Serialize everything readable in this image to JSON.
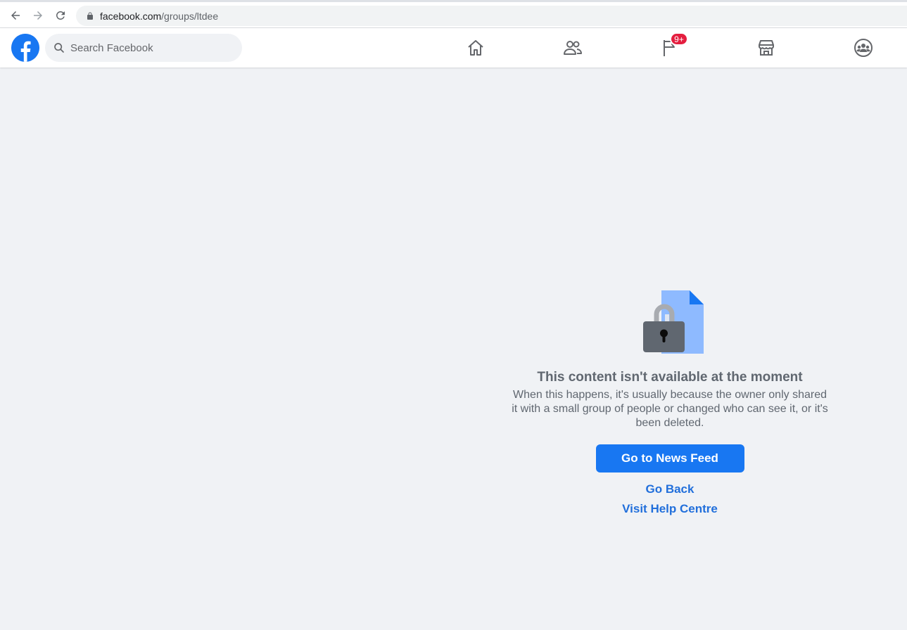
{
  "browser": {
    "url_host": "facebook.com",
    "url_path": "/groups/ltdee"
  },
  "header": {
    "search_placeholder": "Search Facebook",
    "notification_badge": "9+",
    "nav_icons": [
      "home-icon",
      "friends-icon",
      "pages-icon",
      "marketplace-icon",
      "groups-icon"
    ]
  },
  "main": {
    "title": "This content isn't available at the moment",
    "description": "When this happens, it's usually because the owner only shared it with a small group of people or changed who can see it, or it's been deleted.",
    "primary_button": "Go to News Feed",
    "back_link": "Go Back",
    "help_link": "Visit Help Centre"
  },
  "colors": {
    "brand": "#1877f2",
    "badge": "#e41e3f",
    "link": "#216fdb",
    "background": "#f0f2f5"
  }
}
